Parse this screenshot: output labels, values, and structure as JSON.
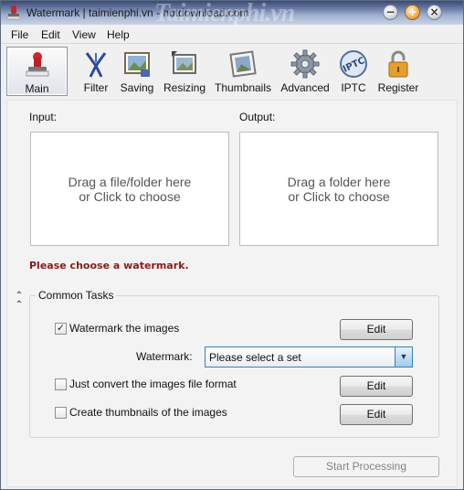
{
  "window": {
    "title": "Watermark | taimienphi.vn - hotdownload.com",
    "watermark_overlay": "Taimienphi.vn"
  },
  "menu": [
    "File",
    "Edit",
    "View",
    "Help"
  ],
  "toolbar": {
    "active": "Main",
    "items": [
      {
        "label": "Main",
        "icon": "stamp-icon"
      },
      {
        "label": "Filter",
        "icon": "filter-icon"
      },
      {
        "label": "Saving",
        "icon": "picture-save-icon"
      },
      {
        "label": "Resizing",
        "icon": "resize-picture-icon"
      },
      {
        "label": "Thumbnails",
        "icon": "thumbnails-icon"
      },
      {
        "label": "Advanced",
        "icon": "gear-icon"
      },
      {
        "label": "IPTC",
        "icon": "iptc-icon"
      },
      {
        "label": "Register",
        "icon": "padlock-icon"
      }
    ]
  },
  "input": {
    "label": "Input:",
    "line1": "Drag a file/folder here",
    "line2": "or Click to choose"
  },
  "output": {
    "label": "Output:",
    "line1": "Drag a folder here",
    "line2": "or Click to choose"
  },
  "warning": "Please choose a watermark.",
  "common_tasks": {
    "title": "Common Tasks",
    "watermark_images": {
      "label": "Watermark the images",
      "checked": true,
      "button": "Edit"
    },
    "watermark_select": {
      "label": "Watermark:",
      "value": "Please select a set"
    },
    "convert_format": {
      "label": "Just convert the images file format",
      "checked": false,
      "button": "Edit"
    },
    "create_thumbnails": {
      "label": "Create thumbnails of the images",
      "checked": false,
      "button": "Edit"
    }
  },
  "start_button": "Start Processing",
  "colors": {
    "warning": "#8b1a1a",
    "select_border": "#3c7fb1",
    "titlebar": "#6f7fa8"
  }
}
